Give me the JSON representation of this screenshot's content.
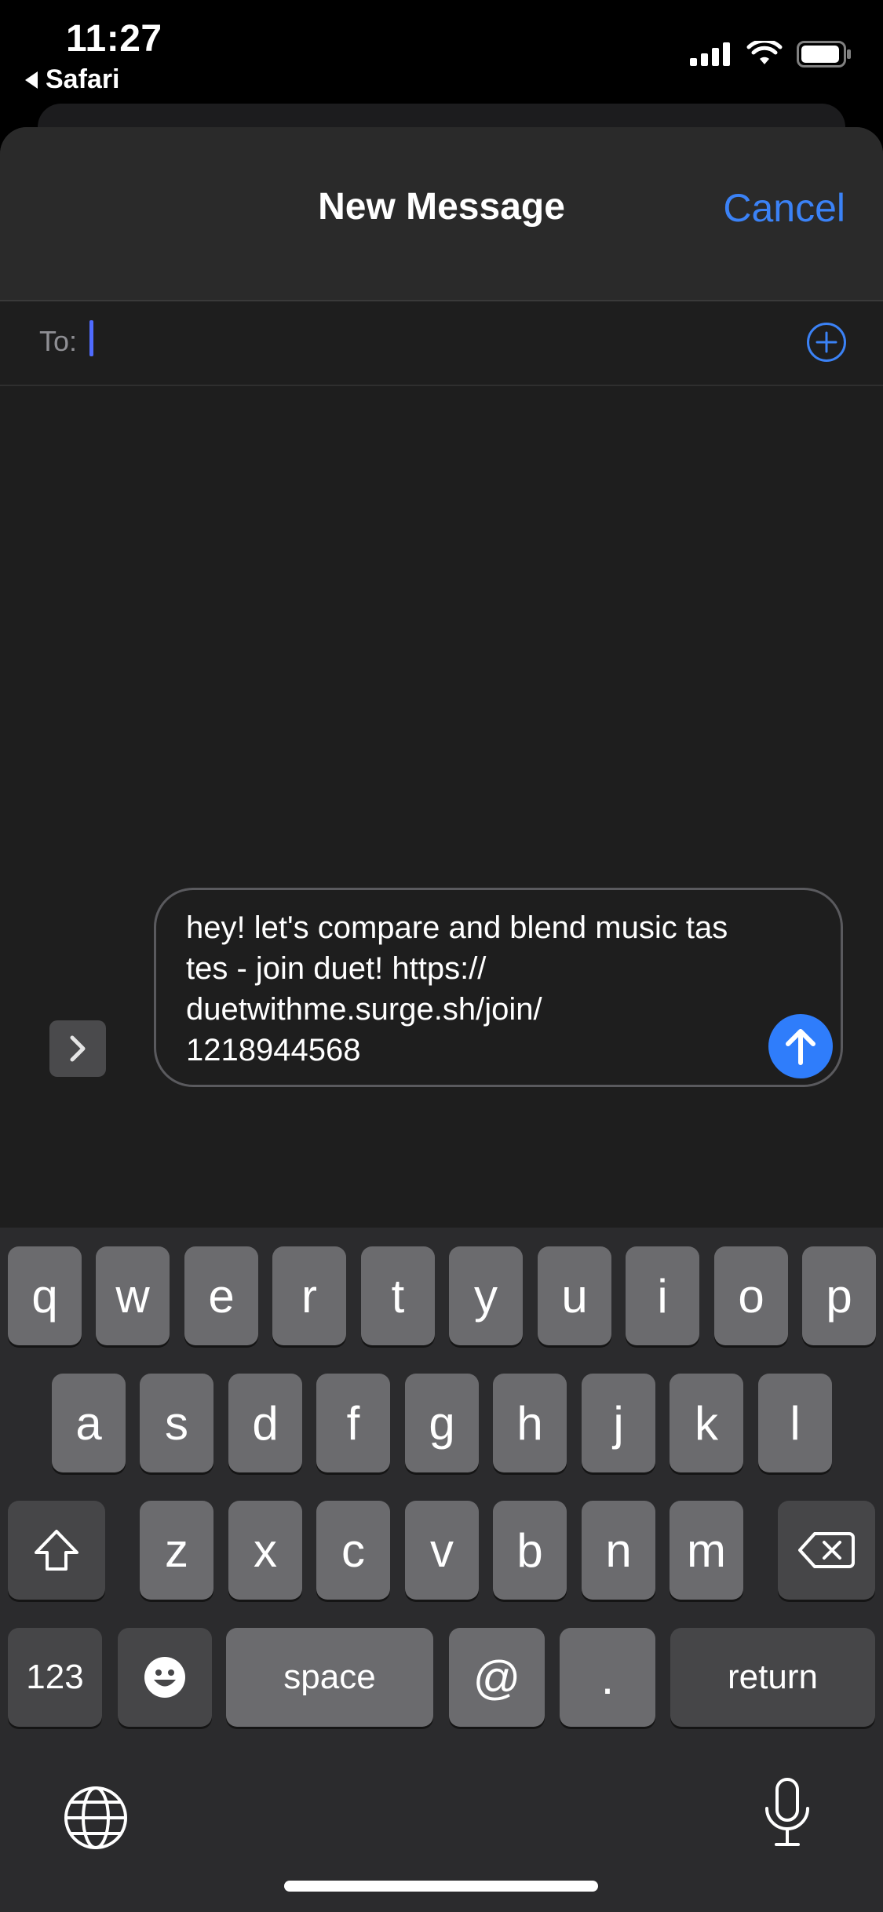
{
  "status": {
    "time": "11:27",
    "back_app": "Safari"
  },
  "nav": {
    "title": "New Message",
    "cancel": "Cancel"
  },
  "to": {
    "label": "To:"
  },
  "message": {
    "text": "hey! let's compare and blend music tastes - join duet! https://\nduetwithme.surge.sh/join/\n1218944568"
  },
  "keyboard": {
    "row1": [
      "q",
      "w",
      "e",
      "r",
      "t",
      "y",
      "u",
      "i",
      "o",
      "p"
    ],
    "row2": [
      "a",
      "s",
      "d",
      "f",
      "g",
      "h",
      "j",
      "k",
      "l"
    ],
    "row3": [
      "z",
      "x",
      "c",
      "v",
      "b",
      "n",
      "m"
    ],
    "numbers": "123",
    "space": "space",
    "at": "@",
    "period": ".",
    "return": "return"
  },
  "colors": {
    "accent": "#3b82f6",
    "send": "#2f7dfb",
    "caret": "#4f6bff"
  }
}
